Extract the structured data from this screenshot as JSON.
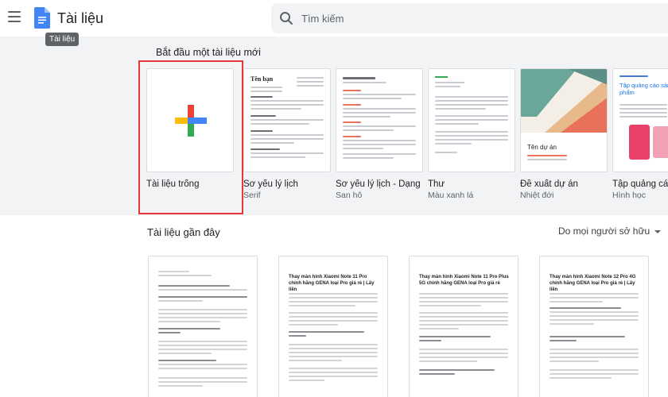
{
  "header": {
    "app_title": "Tài liệu",
    "tooltip": "Tài liệu",
    "search_placeholder": "Tìm kiếm"
  },
  "templates": {
    "heading": "Bắt đầu một tài liệu mới",
    "items": [
      {
        "name": "Tài liệu trống",
        "sub": ""
      },
      {
        "name": "Sơ yếu lý lịch",
        "sub": "Serif",
        "thumb_title": "Tên bạn"
      },
      {
        "name": "Sơ yếu lý lịch - Dạng",
        "sub": "San hô"
      },
      {
        "name": "Thư",
        "sub": "Màu xanh lá"
      },
      {
        "name": "Đề xuất dự án",
        "sub": "Nhiệt đới",
        "thumb_title": "Tên dự án"
      },
      {
        "name": "Tập quảng cáo",
        "sub": "Hình học",
        "thumb_title": "Tập quảng cáo sản phẩm"
      }
    ]
  },
  "recent": {
    "heading": "Tài liệu gần đây",
    "owner_filter": "Do mọi người sở hữu",
    "docs": [
      {
        "title": ""
      },
      {
        "title": "Thay màn hình Xiaomi Note 11 Pro chính hãng GENA loại Pro giá rẻ | Lấy liền"
      },
      {
        "title": "Thay màn hình Xiaomi Note 11 Pro Plus 5G chính hãng GENA loại Pro giá rẻ"
      },
      {
        "title": "Thay màn hình Xiaomi Note 12 Pro 4G chính hãng GENA loại Pro giá rẻ | Lấy liền"
      }
    ]
  },
  "colors": {
    "header_bg": "#ffffff",
    "templates_bg": "#f1f3f4",
    "highlight": "#e53935",
    "docs_blue": "#4285f4"
  }
}
